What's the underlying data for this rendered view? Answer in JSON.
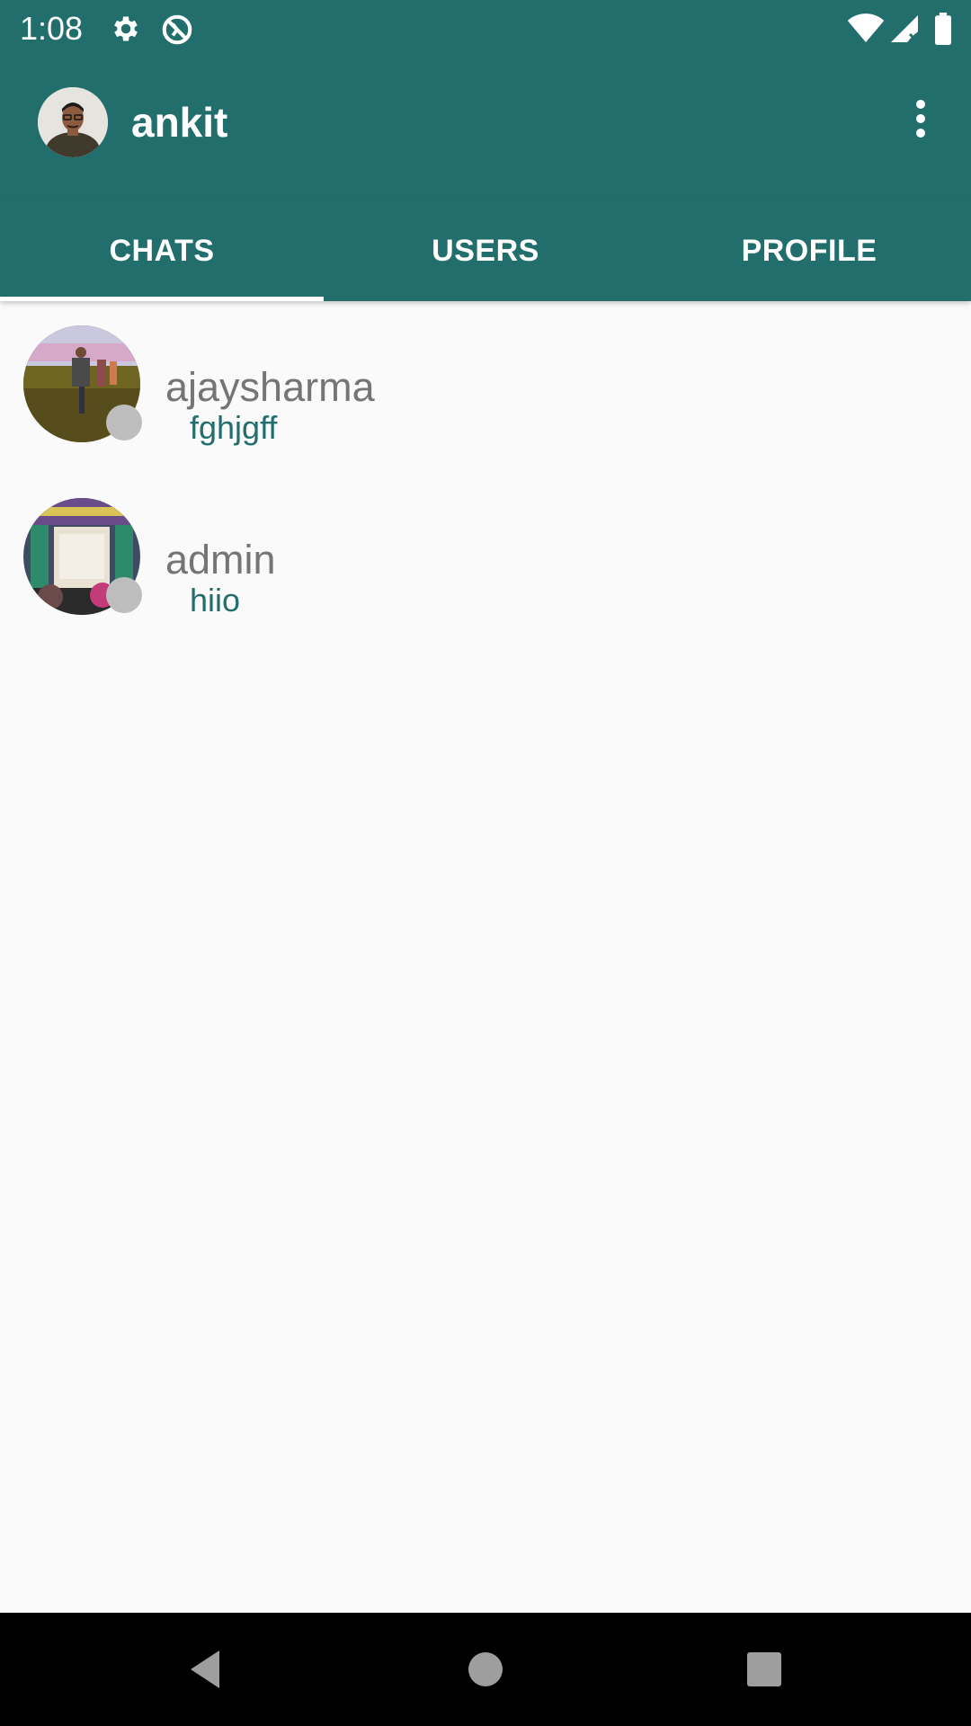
{
  "status_bar": {
    "time": "1:08",
    "icons": [
      "gear-icon",
      "no-sync-icon",
      "wifi-icon",
      "signal-icon",
      "battery-icon"
    ]
  },
  "app_bar": {
    "title": "ankit",
    "menu_icon": "more-vertical-icon"
  },
  "tabs": [
    {
      "label": "CHATS",
      "selected": true
    },
    {
      "label": "USERS",
      "selected": false
    },
    {
      "label": "PROFILE",
      "selected": false
    }
  ],
  "chats": [
    {
      "name": "ajaysharma",
      "last_message": "fghjgff",
      "online": false
    },
    {
      "name": "admin",
      "last_message": "hiio",
      "online": false
    }
  ],
  "nav_bar": {
    "buttons": [
      "back-icon",
      "home-icon",
      "recents-icon"
    ]
  },
  "colors": {
    "primary": "#226e6d",
    "background": "#fafafa",
    "offline_dot": "#bdbdbd",
    "name_text": "#757575"
  }
}
